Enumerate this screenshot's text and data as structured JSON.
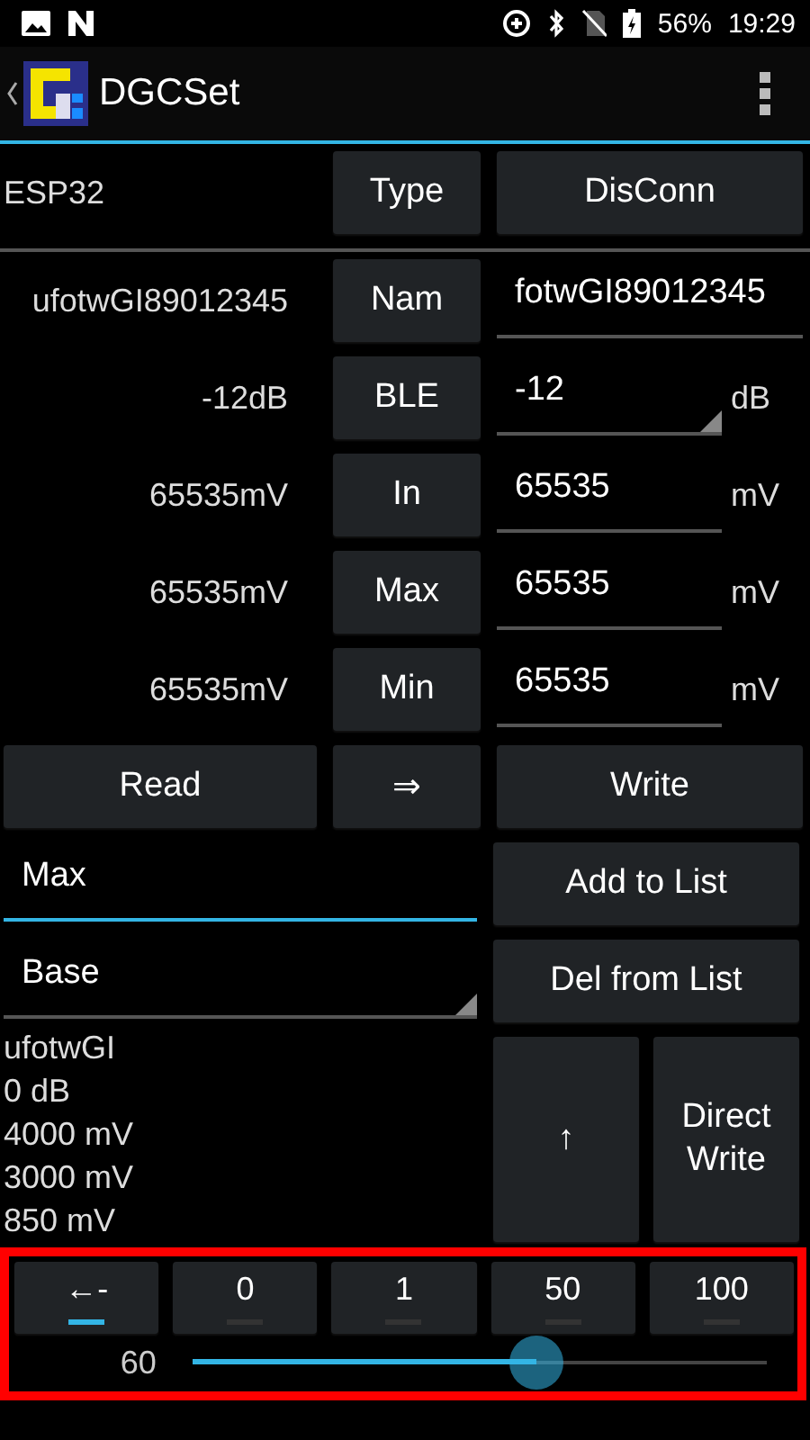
{
  "status_bar": {
    "battery": "56%",
    "time": "19:29"
  },
  "app_bar": {
    "title": "DGCSet"
  },
  "device_row": {
    "name": "ESP32",
    "buttons": [
      "Type",
      "DisConn"
    ]
  },
  "params": [
    {
      "kind": "text",
      "reading": "ufotwGI89012345",
      "button": "Nam",
      "value": "fotwGI89012345"
    },
    {
      "kind": "spinner",
      "reading": "-12dB",
      "button": "BLE",
      "value": "-12",
      "unit": "dB"
    },
    {
      "kind": "text",
      "reading": "65535mV",
      "button": "In",
      "value": "65535",
      "unit": "mV"
    },
    {
      "kind": "text",
      "reading": "65535mV",
      "button": "Max",
      "value": "65535",
      "unit": "mV"
    },
    {
      "kind": "text",
      "reading": "65535mV",
      "button": "Min",
      "value": "65535",
      "unit": "mV"
    }
  ],
  "actions": [
    "Read",
    "⇒",
    "Write"
  ],
  "list_field": {
    "value": "Max",
    "focused": true
  },
  "list_buttons": [
    "Add to List",
    "Del from List"
  ],
  "list_spinner": {
    "value": "Base"
  },
  "info_lines": [
    "ufotwGI",
    "0 dB",
    "4000 mV",
    "3000 mV",
    "850 mV"
  ],
  "move_buttons": [
    "↑",
    "Direct Write"
  ],
  "steps": [
    {
      "label": "←-",
      "selected": true
    },
    {
      "label": "0",
      "selected": false
    },
    {
      "label": "1",
      "selected": false
    },
    {
      "label": "50",
      "selected": false
    },
    {
      "label": "100",
      "selected": false
    }
  ],
  "slider": {
    "reading": "60",
    "level": 0.6
  }
}
